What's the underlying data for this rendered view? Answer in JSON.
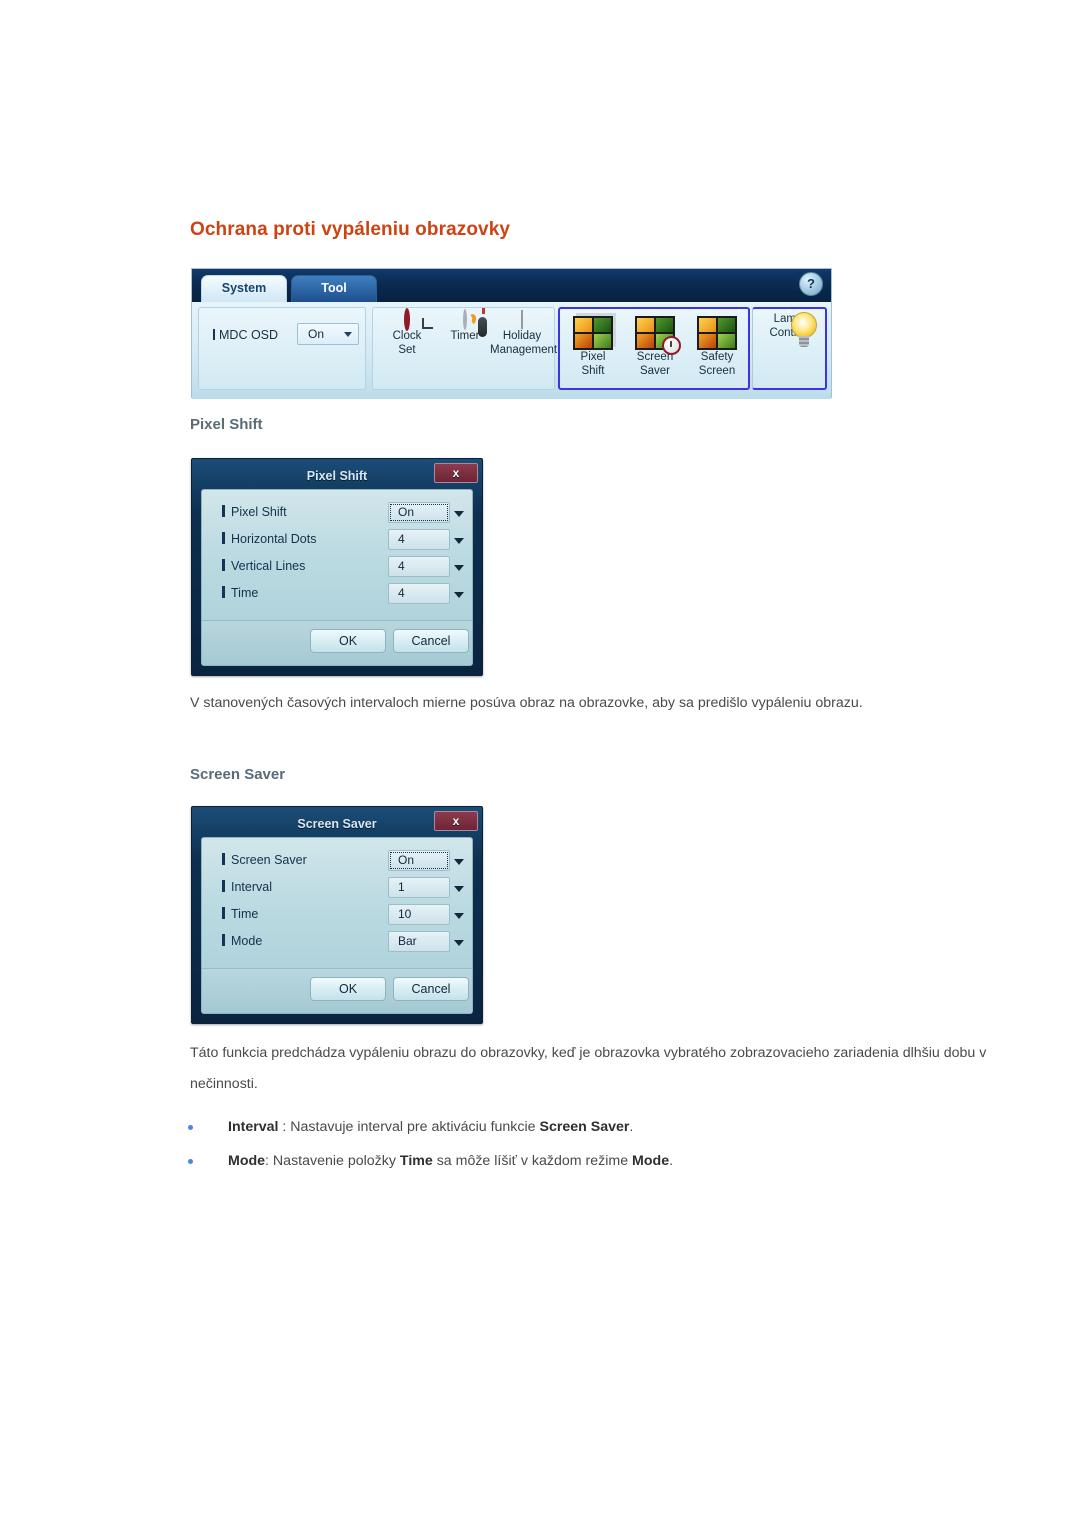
{
  "document": {
    "title": "Ochrana proti vypáleniu obrazovky"
  },
  "mdc_toolbar": {
    "tabs": [
      {
        "label": "System",
        "active": true
      },
      {
        "label": "Tool",
        "active": false
      }
    ],
    "help_label": "?",
    "osd": {
      "label": "MDC OSD",
      "value": "On"
    },
    "buttons": [
      {
        "line1": "Clock",
        "line2": "Set",
        "icon": "clock-icon"
      },
      {
        "line1": "Timer",
        "line2": "",
        "icon": "timer-icon"
      },
      {
        "line1": "Holiday",
        "line2": "Management",
        "icon": "calendar-icon"
      },
      {
        "line1": "Pixel",
        "line2": "Shift",
        "icon": "pixel-shift-icon"
      },
      {
        "line1": "Screen",
        "line2": "Saver",
        "icon": "screen-saver-icon"
      },
      {
        "line1": "Safety",
        "line2": "Screen",
        "icon": "safety-screen-icon"
      },
      {
        "line1": "Lamp",
        "line2": "Control",
        "icon": "lamp-icon"
      }
    ]
  },
  "sections": {
    "pixel_shift": {
      "heading": "Pixel Shift",
      "dialog": {
        "title": "Pixel Shift",
        "close_label": "x",
        "rows": [
          {
            "label": "Pixel Shift",
            "value": "On"
          },
          {
            "label": "Horizontal Dots",
            "value": "4"
          },
          {
            "label": "Vertical Lines",
            "value": "4"
          },
          {
            "label": "Time",
            "value": "4"
          }
        ],
        "ok_label": "OK",
        "cancel_label": "Cancel"
      },
      "paragraph": "V stanovených časových intervaloch mierne posúva obraz na obrazovke, aby sa predišlo vypáleniu obrazu."
    },
    "screen_saver": {
      "heading": "Screen Saver",
      "dialog": {
        "title": "Screen Saver",
        "close_label": "x",
        "rows": [
          {
            "label": "Screen Saver",
            "value": "On"
          },
          {
            "label": "Interval",
            "value": "1"
          },
          {
            "label": "Time",
            "value": "10"
          },
          {
            "label": "Mode",
            "value": "Bar"
          }
        ],
        "ok_label": "OK",
        "cancel_label": "Cancel"
      },
      "paragraph": "Táto funkcia predchádza vypáleniu obrazu do obrazovky, keď je obrazovka vybratého zobrazovacieho zariadenia dlhšiu dobu v nečinnosti.",
      "bullets": [
        {
          "term": "Interval",
          "mid": " : Nastavuje interval pre aktiváciu funkcie ",
          "term2": "Screen Saver",
          "end": "."
        },
        {
          "term": "Mode",
          "mid": ": Nastavenie položky ",
          "term2": "Time",
          "mid2": " sa môže líšiť v každom režime ",
          "term3": "Mode",
          "end": "."
        }
      ]
    }
  },
  "colors": {
    "title_accent": "#cc4413",
    "subheading": "#5a6b78",
    "bullet": "#4a86e8",
    "dialog_frame": "#0d2f50",
    "close_button": "#8e3a4d",
    "ribbon_selection": "#3a35e0"
  }
}
